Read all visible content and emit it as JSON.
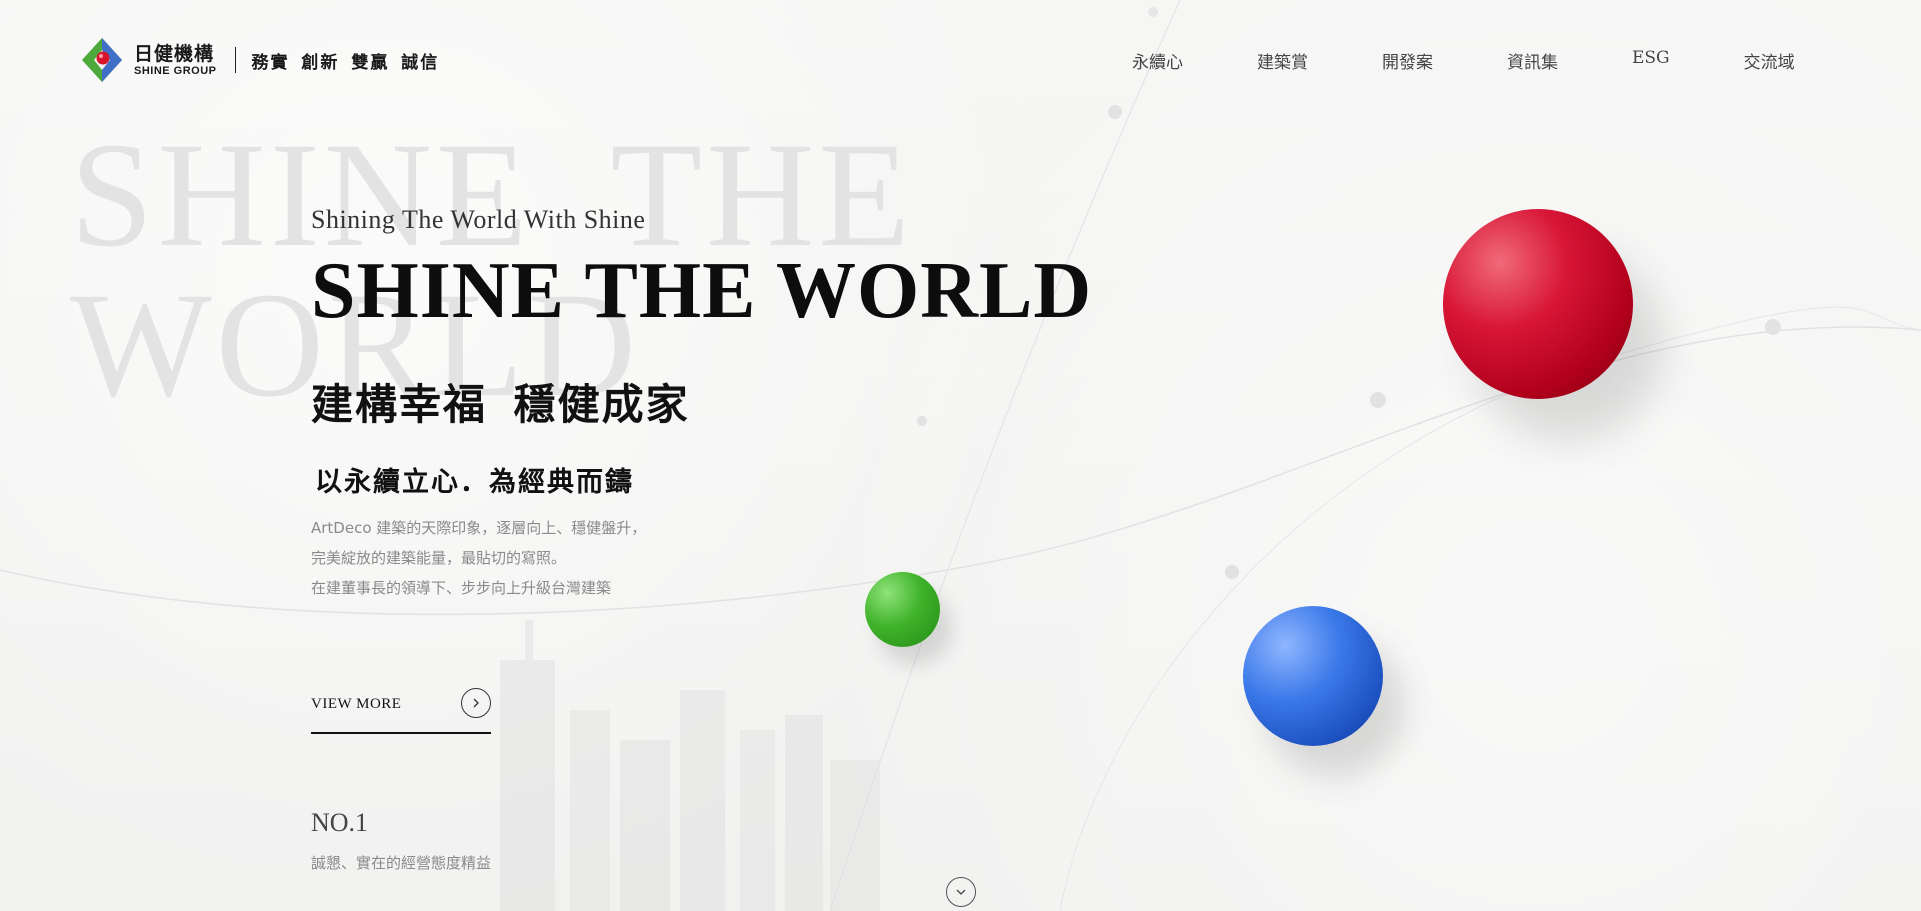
{
  "brand": {
    "name_zh": "日健機構",
    "name_en": "SHINE GROUP",
    "slogan": "務實 創新 雙贏 誠信"
  },
  "nav": {
    "items": [
      {
        "label": "永續心"
      },
      {
        "label": "建築賞"
      },
      {
        "label": "開發案"
      },
      {
        "label": "資訊集"
      },
      {
        "label": "ESG"
      },
      {
        "label": "交流域"
      }
    ]
  },
  "background": {
    "watermark": "SHINE THE WORLD"
  },
  "hero": {
    "tagline": "Shining The World With Shine",
    "headline": "SHINE THE WORLD",
    "zh_title": "建構幸福 穩健成家",
    "zh_subtitle": "以永續立心．為經典而鑄",
    "description": [
      "ArtDeco 建築的天際印象，逐層向上、穩健盤升，",
      "完美綻放的建築能量，最貼切的寫照。",
      "在建董事長的領導下、步步向上升級台灣建築"
    ],
    "view_more_label": "VIEW MORE"
  },
  "stat": {
    "number": "NO.1",
    "description": "誠懇、實在的經營態度精益"
  },
  "colors": {
    "background": "#f3f3f2",
    "ball_red": "#d0102e",
    "ball_green": "#3fb32a",
    "ball_blue": "#2b63d6",
    "logo_green": "#4caa3b",
    "logo_blue": "#3f6fc7",
    "logo_red": "#d8142b"
  },
  "icons": {
    "view_more": "chevron-right-icon",
    "scroll_down": "chevron-down-icon",
    "logo": "shine-group-logo-icon"
  }
}
